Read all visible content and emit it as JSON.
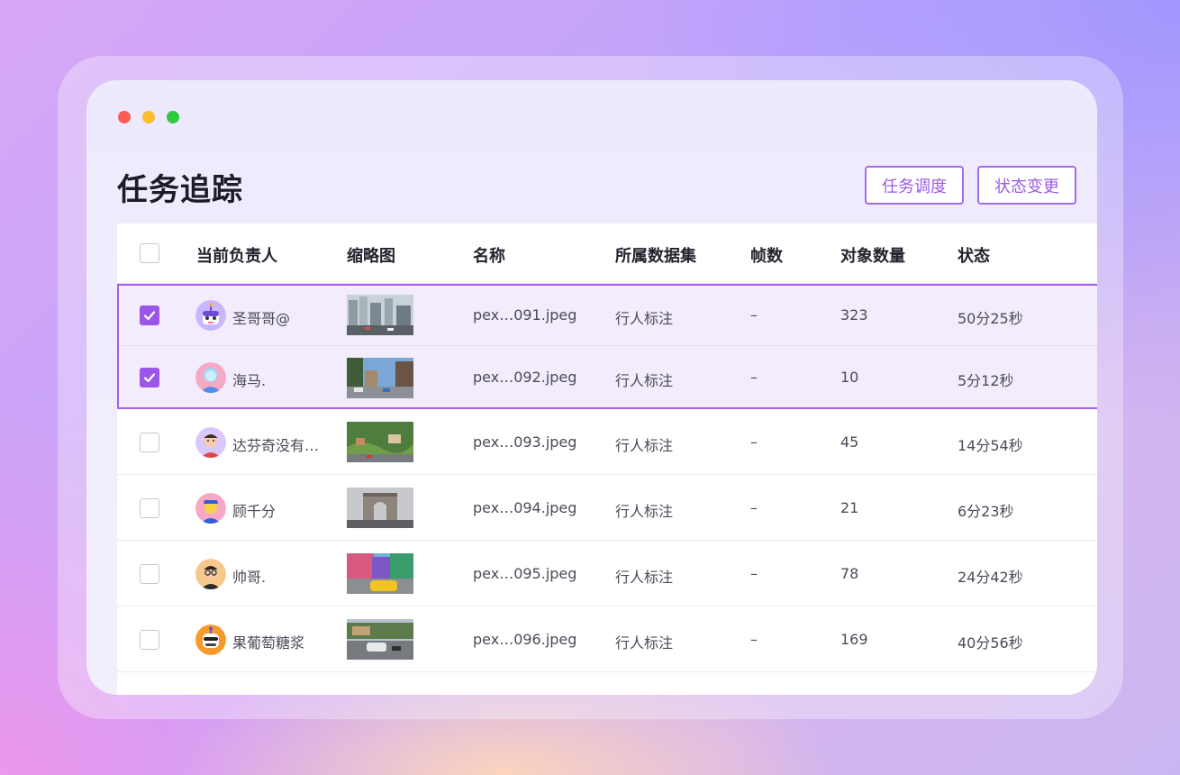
{
  "window": {
    "title": "任务追踪",
    "buttons": {
      "dispatch": "任务调度",
      "status_change": "状态变更"
    }
  },
  "table": {
    "columns": [
      "当前负责人",
      "缩略图",
      "名称",
      "所属数据集",
      "帧数",
      "对象数量",
      "状态"
    ],
    "rows": [
      {
        "checked": true,
        "owner": "圣哥哥@",
        "avatar": "robot-avatar-icon",
        "name": "pex…091.jpeg",
        "dataset": "行人标注",
        "frames": "–",
        "objects": "323",
        "status": "50分25秒"
      },
      {
        "checked": true,
        "owner": "海马.",
        "avatar": "girl-avatar-icon",
        "name": "pex…092.jpeg",
        "dataset": "行人标注",
        "frames": "–",
        "objects": "10",
        "status": "5分12秒"
      },
      {
        "checked": false,
        "owner": "达芬奇没有…",
        "avatar": "boy-avatar-icon",
        "name": "pex…093.jpeg",
        "dataset": "行人标注",
        "frames": "–",
        "objects": "45",
        "status": "14分54秒"
      },
      {
        "checked": false,
        "owner": "顾千分",
        "avatar": "cap-avatar-icon",
        "name": "pex…094.jpeg",
        "dataset": "行人标注",
        "frames": "–",
        "objects": "21",
        "status": "6分23秒"
      },
      {
        "checked": false,
        "owner": "帅哥.",
        "avatar": "glasses-avatar-icon",
        "name": "pex…095.jpeg",
        "dataset": "行人标注",
        "frames": "–",
        "objects": "78",
        "status": "24分42秒"
      },
      {
        "checked": false,
        "owner": "果葡萄糖浆",
        "avatar": "mask-avatar-icon",
        "name": "pex…096.jpeg",
        "dataset": "行人标注",
        "frames": "–",
        "objects": "169",
        "status": "40分56秒"
      }
    ]
  },
  "colors": {
    "accent": "#9b55e8",
    "selected_row": "#f2ecfd"
  }
}
